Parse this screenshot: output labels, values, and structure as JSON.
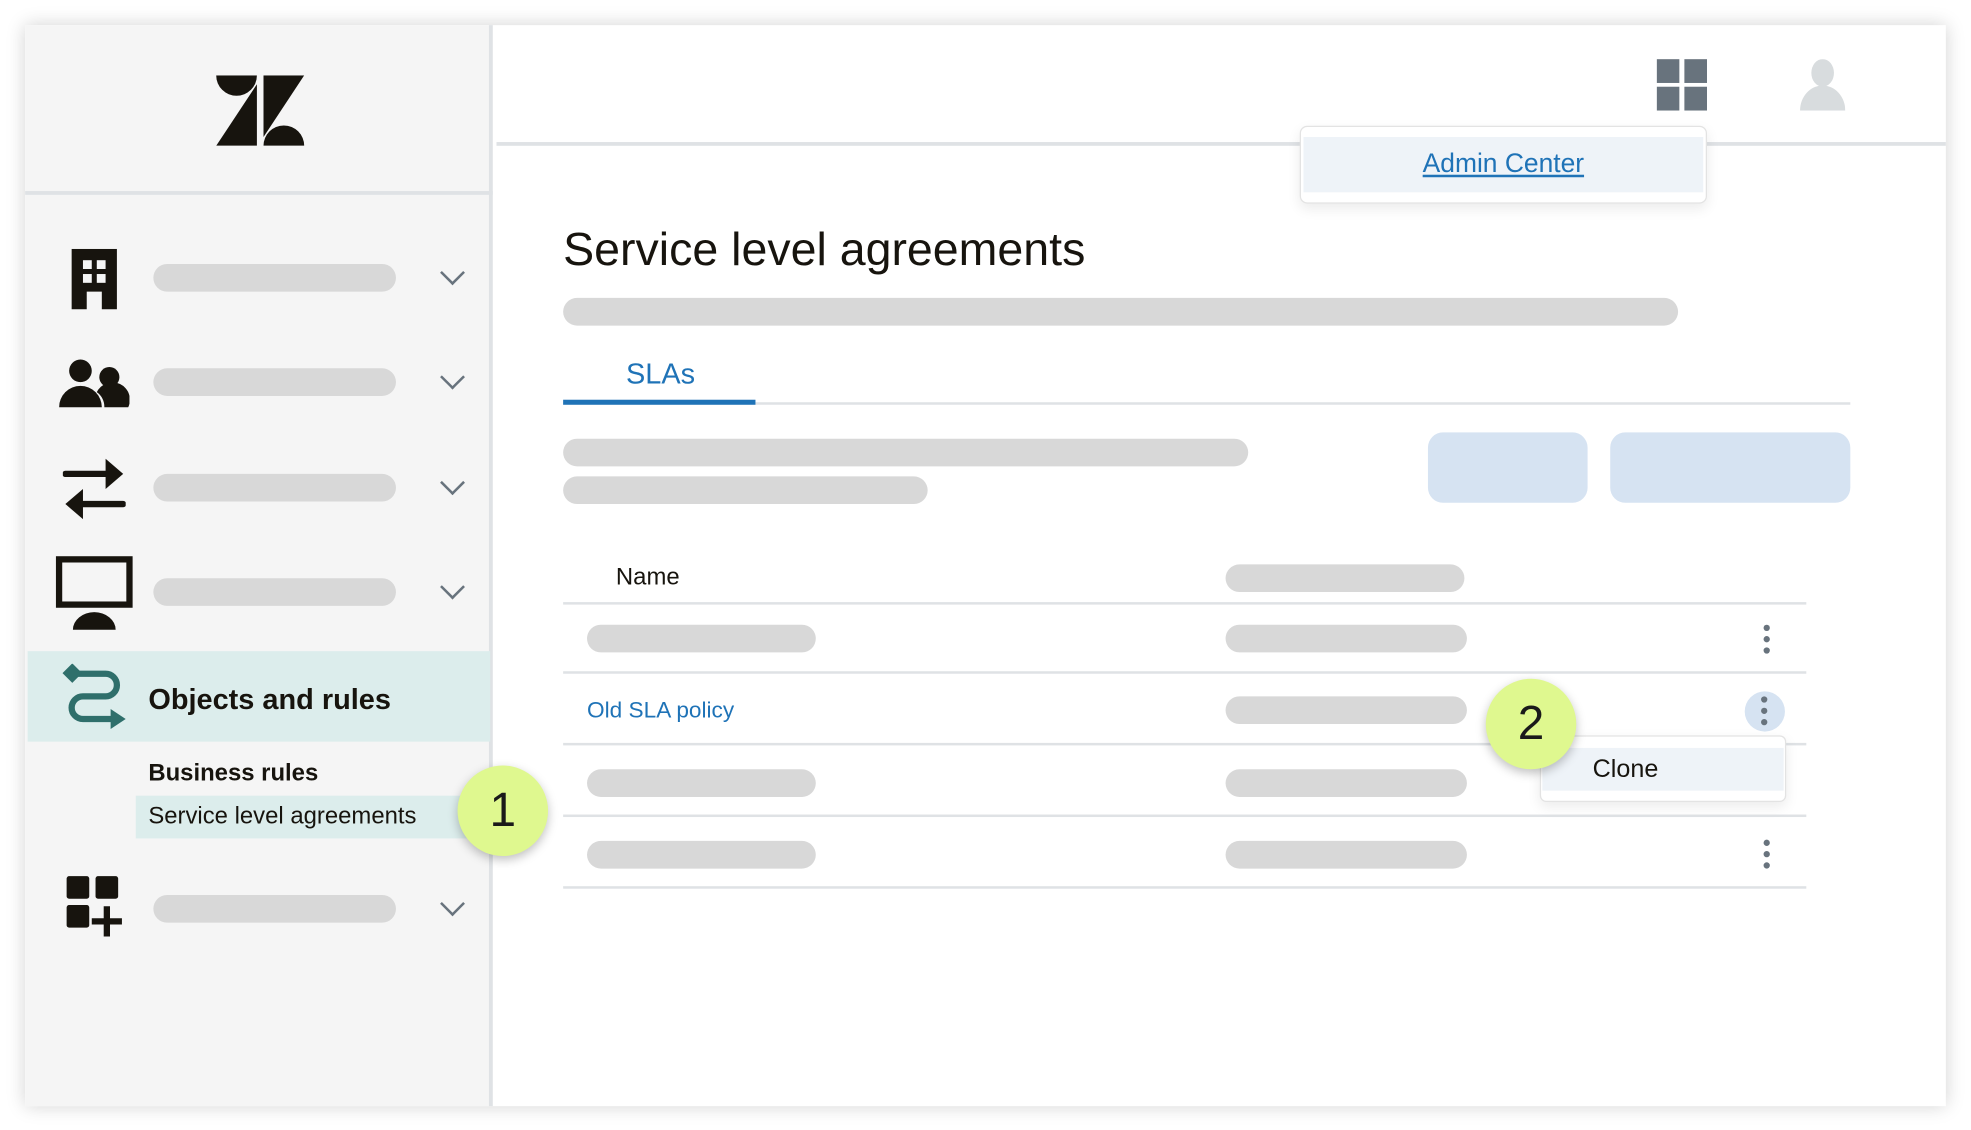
{
  "sidebar": {
    "items": [
      {
        "icon": "building-icon"
      },
      {
        "icon": "people-icon"
      },
      {
        "icon": "arrows-exchange-icon"
      },
      {
        "icon": "monitor-icon"
      }
    ],
    "active": {
      "icon": "objects-rules-icon",
      "label": "Objects and rules"
    },
    "subitems": [
      {
        "label": "Business rules"
      },
      {
        "label": "Service level agreements",
        "selected": true
      }
    ],
    "last": {
      "icon": "apps-add-icon"
    }
  },
  "header": {
    "admin_center": "Admin Center",
    "icons": [
      "grid-icon",
      "user-avatar-icon"
    ]
  },
  "main": {
    "title": "Service level agreements",
    "tabs": [
      {
        "label": "SLAs",
        "active": true
      }
    ],
    "table": {
      "columns": [
        "Name"
      ],
      "rows": [
        {
          "name": ""
        },
        {
          "name": "Old SLA policy",
          "menu_open": true
        },
        {
          "name": ""
        },
        {
          "name": ""
        }
      ]
    },
    "menu": {
      "items": [
        "Clone"
      ]
    }
  },
  "callouts": [
    "1",
    "2"
  ],
  "colors": {
    "accent": "#1f73b7",
    "callout": "#dff88f",
    "active_bg": "#dcedec",
    "button_bg": "#d6e3f2"
  }
}
